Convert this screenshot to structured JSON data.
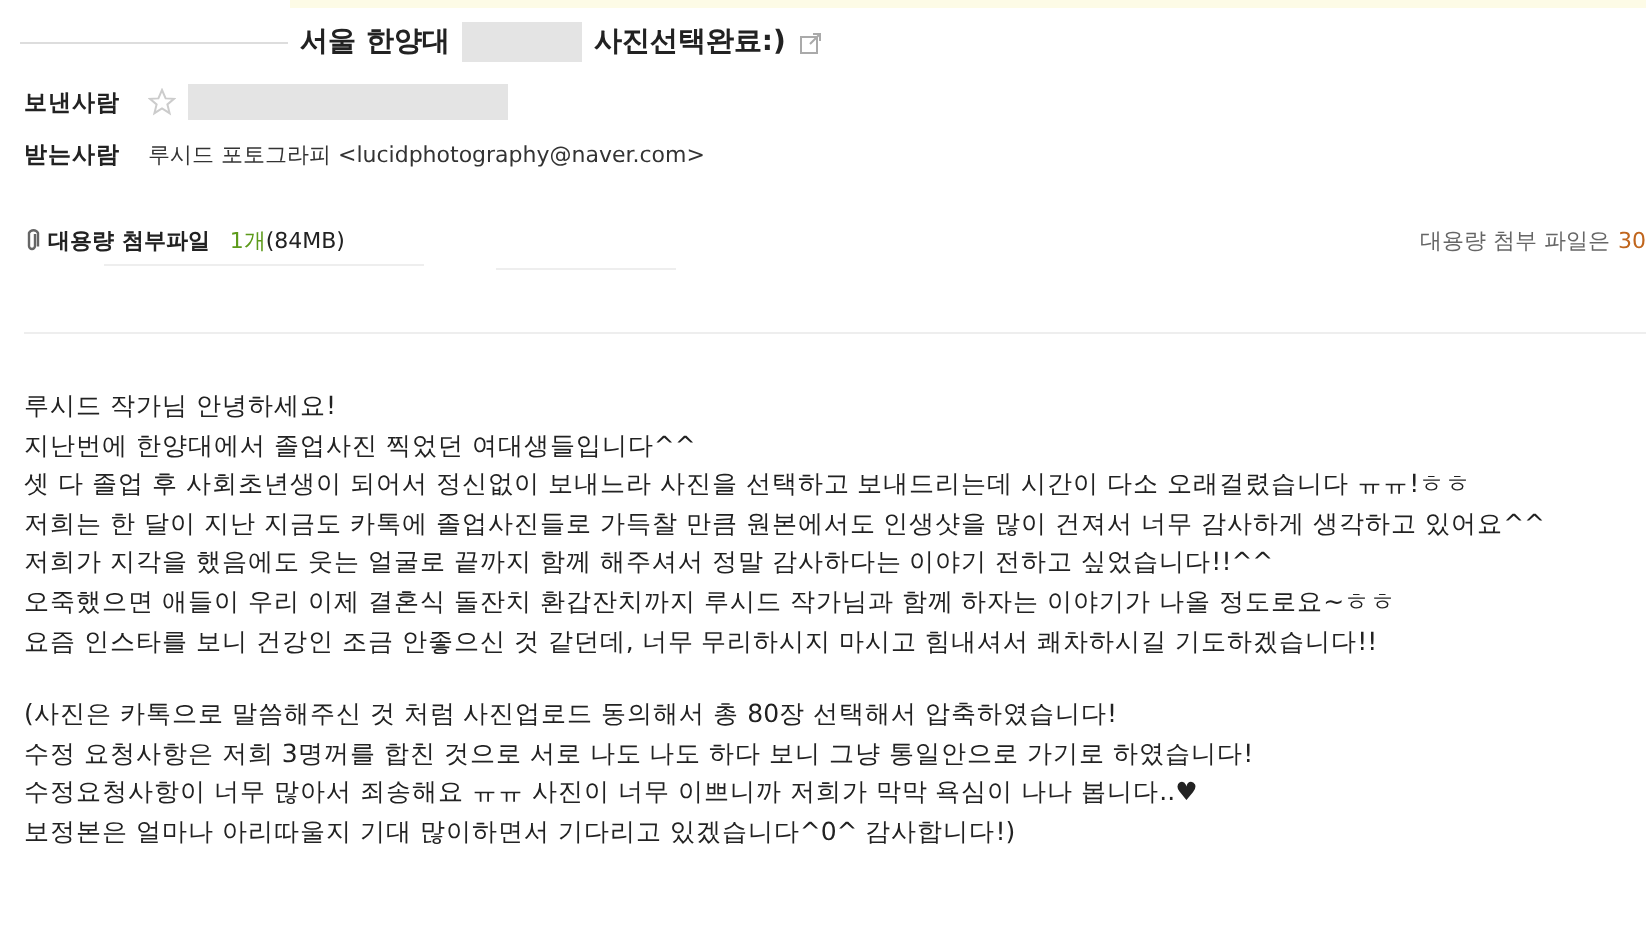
{
  "subject": {
    "before": "서울 한양대",
    "after": "사진선택완료:)"
  },
  "sender": {
    "label": "보낸사람",
    "starred": false
  },
  "recipient": {
    "label": "받는사람",
    "value": "루시드 포토그라피 <lucidphotography@naver.com>"
  },
  "attachment": {
    "label": "대용량 첨부파일",
    "count": "1개",
    "size": "(84MB)",
    "notice": "대용량 첨부 파일은",
    "days": "30"
  },
  "body": {
    "paragraphs": [
      [
        "루시드 작가님 안녕하세요!",
        "지난번에 한양대에서 졸업사진 찍었던 여대생들입니다^^",
        "셋 다 졸업 후 사회초년생이 되어서 정신없이 보내느라 사진을 선택하고 보내드리는데 시간이 다소 오래걸렸습니다 ㅠㅠ!ㅎㅎ",
        "저희는 한 달이 지난 지금도 카톡에 졸업사진들로 가득찰 만큼 원본에서도 인생샷을 많이 건져서 너무 감사하게 생각하고 있어요^^",
        "저희가 지각을 했음에도 웃는 얼굴로 끝까지 함께 해주셔서 정말 감사하다는 이야기 전하고 싶었습니다!!^^",
        "오죽했으면 애들이 우리 이제 결혼식 돌잔치 환갑잔치까지 루시드 작가님과 함께 하자는 이야기가 나올 정도로요~ㅎㅎ",
        "요즘 인스타를 보니 건강인 조금 안좋으신 것 같던데, 너무 무리하시지 마시고 힘내셔서 쾌차하시길 기도하겠습니다!!"
      ],
      [
        "(사진은 카톡으로 말씀해주신 것 처럼 사진업로드 동의해서 총 80장 선택해서 압축하였습니다!",
        "수정 요청사항은 저희 3명꺼를 합친 것으로 서로 나도 나도 하다 보니 그냥 통일안으로 가기로 하였습니다!",
        "수정요청사항이 너무 많아서 죄송해요 ㅠㅠ 사진이 너무 이쁘니까 저희가 막막 욕심이 나나 봅니다..♥",
        "보정본은 얼마나 아리따울지 기대 많이하면서 기다리고 있겠습니다^0^ 감사합니다!)"
      ]
    ]
  }
}
